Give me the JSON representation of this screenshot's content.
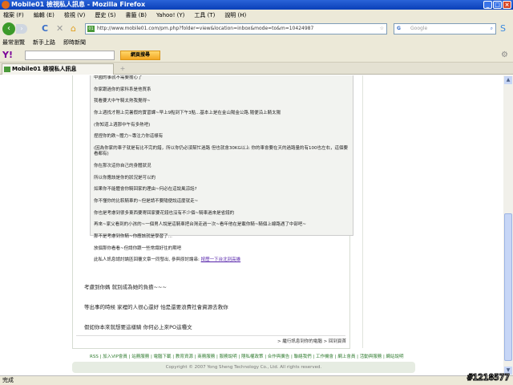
{
  "window": {
    "title": "Mobile01 檢視私人訊息 - Mozilla Firefox"
  },
  "menu": [
    "檔案 (F)",
    "編輯 (E)",
    "檢視 (V)",
    "歷史 (S)",
    "書籤 (B)",
    "Yahoo! (Y)",
    "工具 (T)",
    "說明 (H)"
  ],
  "nav": {
    "url": "http://www.mobile01.com/pm.php?folder=view&location=inbox&mode=to&m=10424987",
    "search_placeholder": "Google"
  },
  "bookmarks": [
    "最常瀏覽",
    "新手上路",
    "即時新聞"
  ],
  "yahoo": {
    "button": "網頁搜尋"
  },
  "tab": {
    "label": "Mobile01 檢視私人訊息"
  },
  "quote": [
    "中國的事就不需要擔心了",
    "你家跟過你的家科系是他買系",
    "我看要大中午騎太熱我覺得~",
    "你上週找才剛上完暑假的實習課~早上9點到下午3點...基本上是在金山陽金公路.隨便沿上騎太陽",
    "(你知道上週那中午有多熱吧)",
    "捏捏你的跌~體力~專注力你這樣有",
    "(因為你家的車子就是有比不完的錯，所以你仍必須幫忙過路 但也就會30KG以上 你的車會要在天的過路量約有100也左右，這個要看都有)",
    "你在那次這你自己的身體狀況",
    "所以你應該是你的狀況是可以的",
    "如果你不能體會你騎回家的理由~何必在這說風涼話?",
    "你不懂你的比較騎車的~但是請不要隨便說這麼就走~",
    "你也是考慮到很多東西要寄回家要花錢也沒有不少個~騎車過來是省錢的",
    "再來~家父看到的小孩的~一個男人說是這騎車把台灣走過一次~看年他在是載你騎~騎個上線路遇了中部吧~",
    "那不是考慮到你騎~你應該就是學習了...",
    "放個那你看看~但請你跟一些常識好住的期吧"
  ],
  "quote_footer": {
    "text": "此私人訊息請討論區回覆文章一同發出, 參與原討論串:",
    "link": "按歷一下台北到高雄"
  },
  "replies": [
    "考慮到你媽 就別成為她的負擔~~~",
    "等出事的時候 家裡的人很心還好 怕是還要浪費社會資源去救你",
    "假如你本來就想要這樣騎 你何必上來PO這種文"
  ],
  "panel_links": "> 繼行訊息到你的電腦  > 回到頁首",
  "footer": {
    "links": "RSS | 加入VIP會員 | 站務服務 | 電腦下載 | 教育資源 | 商務服務 | 服務說明 | 隱私權政策 | 合作與廣告 | 聯絡我們 | 工作機會 | 網上會員 | 活動與服務 | 網站說明",
    "copyright": "Copyright © 2007 Yong Sheng Technology Co., Ltd. All rights reserved."
  },
  "status": "完成",
  "watermark": "#1218577"
}
